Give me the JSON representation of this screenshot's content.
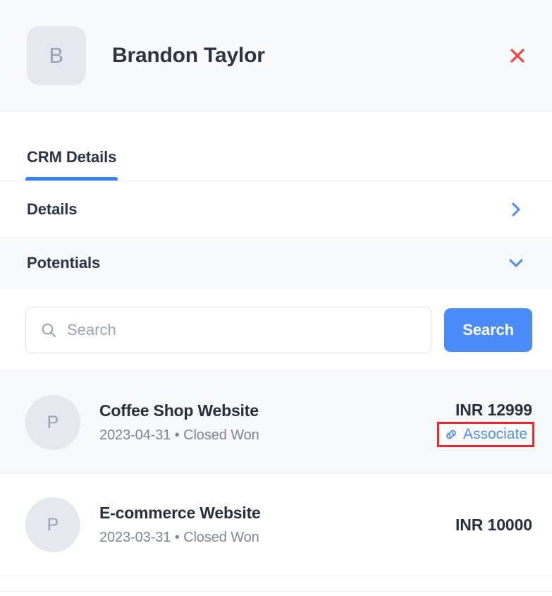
{
  "header": {
    "avatar_initial": "B",
    "title": "Brandon Taylor",
    "close_icon": "close-icon",
    "close_color": "#f4433c"
  },
  "tabs": [
    {
      "label": "CRM Details",
      "active": true
    }
  ],
  "accordion": [
    {
      "label": "Details",
      "icon": "chevron-right-icon",
      "expanded": false
    },
    {
      "label": "Potentials",
      "icon": "chevron-down-icon",
      "expanded": true
    }
  ],
  "search": {
    "icon": "search-icon",
    "placeholder": "Search",
    "value": "",
    "button_label": "Search",
    "button_color": "#4a8cf7"
  },
  "potentials": [
    {
      "avatar_initial": "P",
      "title": "Coffee Shop Website",
      "subtitle": "2023-04-31 • Closed Won",
      "amount": "INR 12999",
      "action_label": "Associate",
      "action_icon": "link-icon",
      "highlighted": true,
      "annotated": true
    },
    {
      "avatar_initial": "P",
      "title": "E-commerce Website",
      "subtitle": "2023-03-31 • Closed Won",
      "amount": "INR 10000",
      "action_label": "",
      "action_icon": "",
      "highlighted": false,
      "annotated": false
    }
  ],
  "colors": {
    "accent_blue": "#3b82f6",
    "link_blue": "#4a8cf7",
    "annotation_red": "#f5252a",
    "close_red": "#f4433c",
    "row_shaded": "#f7f8fa",
    "header_bg": "#f8f9fb",
    "avatar_bg": "#e6e8f0"
  }
}
